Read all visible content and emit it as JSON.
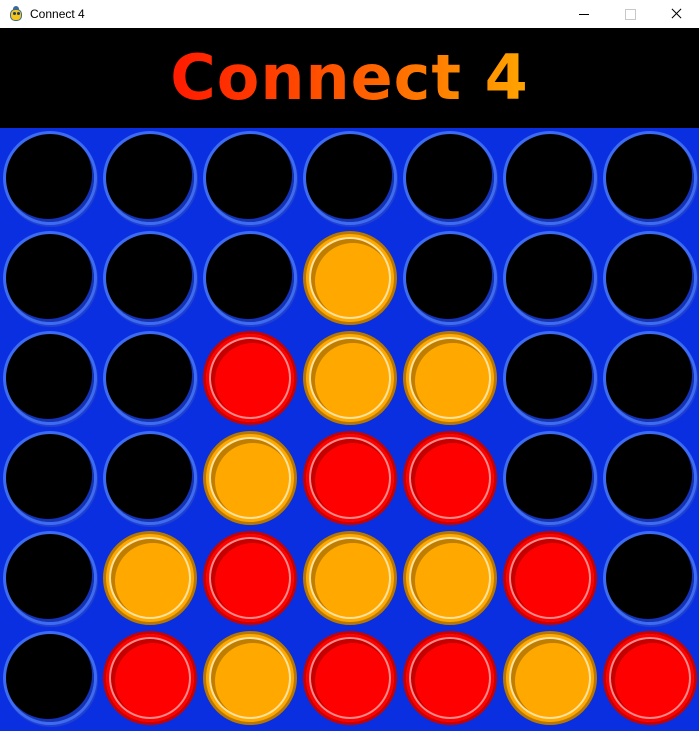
{
  "window": {
    "title": "Connect 4",
    "app_icon": "pygame-snake-icon"
  },
  "header": {
    "title": "Connect 4",
    "gradient_colors": [
      "#ff1a00",
      "#ffa500"
    ]
  },
  "colors": {
    "board": "#0a2fe0",
    "empty_slot": "#000000",
    "red_disc": "#ff0000",
    "yellow_disc": "#ffa800"
  },
  "board": {
    "rows": 6,
    "cols": 7,
    "grid": [
      [
        "empty",
        "empty",
        "empty",
        "empty",
        "empty",
        "empty",
        "empty"
      ],
      [
        "empty",
        "empty",
        "empty",
        "yellow",
        "empty",
        "empty",
        "empty"
      ],
      [
        "empty",
        "empty",
        "red",
        "yellow",
        "yellow",
        "empty",
        "empty"
      ],
      [
        "empty",
        "empty",
        "yellow",
        "red",
        "red",
        "empty",
        "empty"
      ],
      [
        "empty",
        "yellow",
        "red",
        "yellow",
        "yellow",
        "red",
        "empty"
      ],
      [
        "empty",
        "red",
        "yellow",
        "red",
        "red",
        "yellow",
        "red"
      ]
    ]
  }
}
